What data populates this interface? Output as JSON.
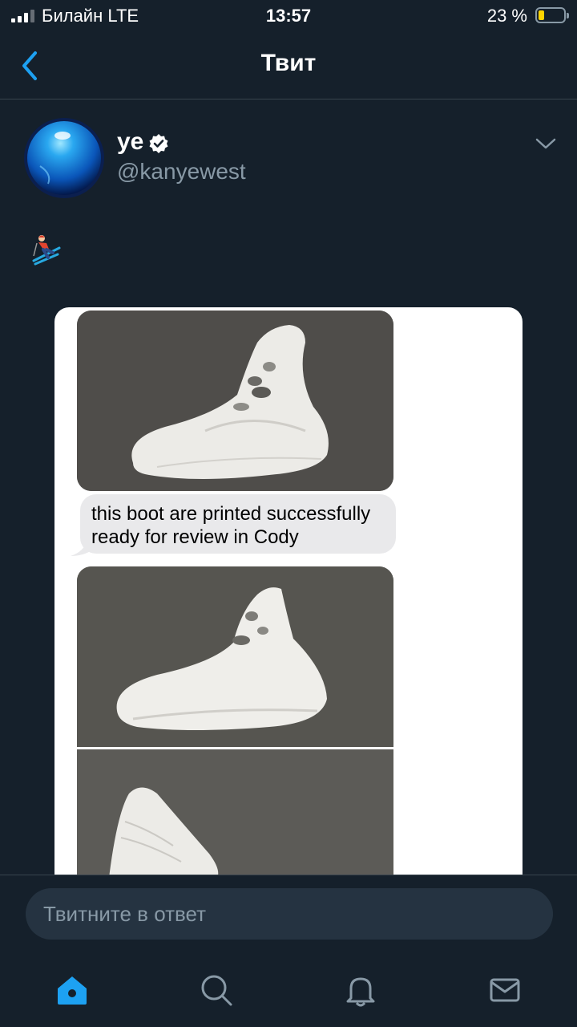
{
  "status_bar": {
    "carrier": "Билайн  LTE",
    "time": "13:57",
    "battery_text": "23 %",
    "battery_level": 0.23
  },
  "header": {
    "title": "Твит",
    "back_icon": "chevron-left-icon"
  },
  "tweet": {
    "author": {
      "name": "ye",
      "handle": "@kanyewest",
      "verified": true
    },
    "text_emoji": "skier-emoji",
    "media": {
      "message_text": "this boot are printed successfully ready for review in Cody"
    }
  },
  "reply": {
    "placeholder": "Твитните в ответ"
  },
  "tab_bar": {
    "items": [
      "home-icon",
      "search-icon",
      "notifications-bell-icon",
      "messages-envelope-icon"
    ],
    "active": "home-icon"
  },
  "colors": {
    "background": "#15202b",
    "accent": "#1da1f2",
    "secondary_text": "#8899a6",
    "divider": "#38444d",
    "battery_fill": "#ffd400",
    "bubble": "#e9e9eb"
  }
}
